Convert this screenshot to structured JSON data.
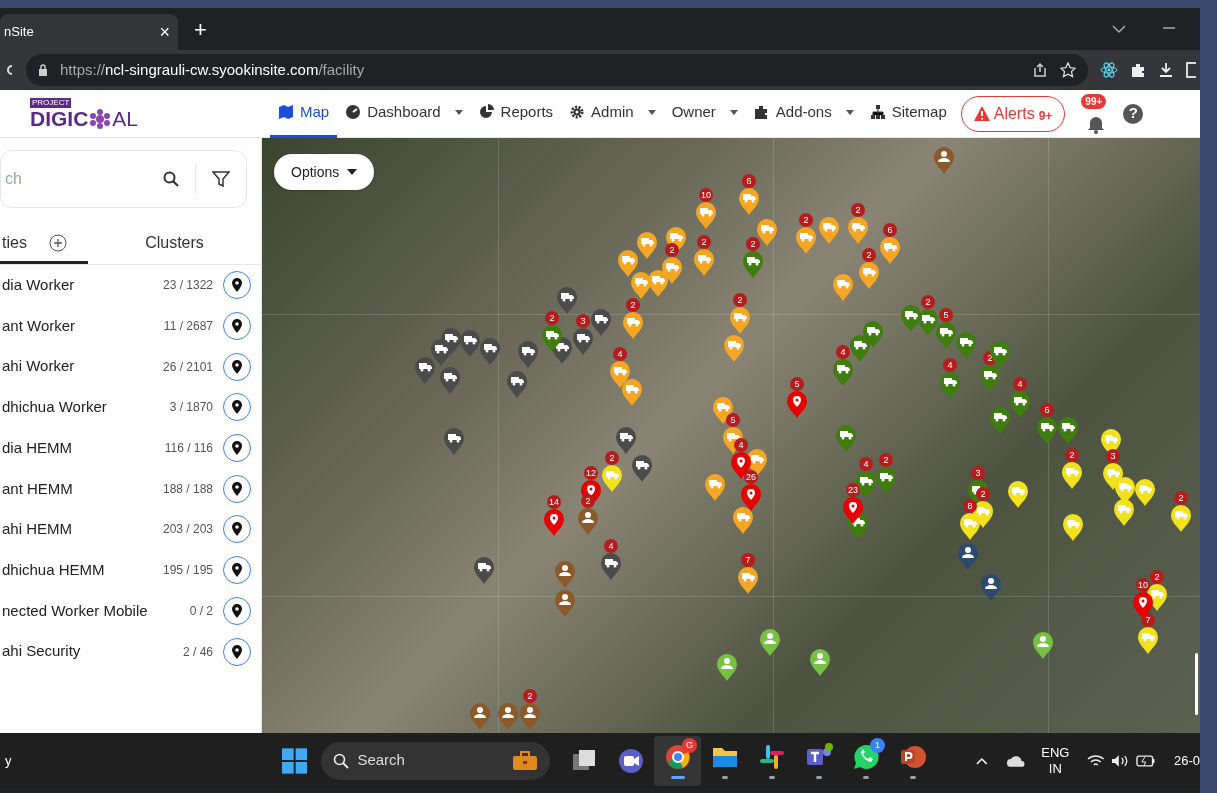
{
  "browser": {
    "tab_title": "nSite",
    "tab_close": "×",
    "new_tab": "+",
    "url_scheme": "https://",
    "url_host": "ncl-singrauli-cw.syookinsite.com",
    "url_path": "/facility"
  },
  "app": {
    "logo_tag": "PROJECT",
    "logo_left": "DIGIC",
    "logo_right": "AL",
    "nav": [
      {
        "label": "Map",
        "dropdown": false,
        "selected": true
      },
      {
        "label": "Dashboard",
        "dropdown": true,
        "selected": false
      },
      {
        "label": "Reports",
        "dropdown": false,
        "selected": false
      },
      {
        "label": "Admin",
        "dropdown": true,
        "selected": false
      },
      {
        "label": "Owner",
        "dropdown": true,
        "selected": false
      },
      {
        "label": "Add-ons",
        "dropdown": true,
        "selected": false
      },
      {
        "label": "Sitemap",
        "dropdown": false,
        "selected": false
      }
    ],
    "alerts": {
      "label": "Alerts",
      "count": "9+"
    },
    "notifications": "99+",
    "help": "?"
  },
  "sidebar": {
    "search": {
      "placeholder": "ch"
    },
    "tabs": [
      {
        "label": "ties",
        "add": true,
        "selected": true
      },
      {
        "label": "Clusters",
        "add": false,
        "selected": false
      }
    ],
    "items": [
      {
        "name": "dia Worker",
        "count": "23 / 1322"
      },
      {
        "name": "ant Worker",
        "count": "11 / 2687"
      },
      {
        "name": "ahi Worker",
        "count": "26 / 2101"
      },
      {
        "name": "dhichua Worker",
        "count": "3 / 1870"
      },
      {
        "name": "dia HEMM",
        "count": "116 / 116"
      },
      {
        "name": "ant HEMM",
        "count": "188 / 188"
      },
      {
        "name": "ahi HEMM",
        "count": "203 / 203"
      },
      {
        "name": "dhichua HEMM",
        "count": "195 / 195"
      },
      {
        "name": "nected Worker Mobile",
        "count": "0 / 2"
      },
      {
        "name": "ahi Security",
        "count": "2 / 46"
      }
    ]
  },
  "map": {
    "options_button": "Options",
    "markers": [
      {
        "kind": "truck",
        "color": "#4b4b4b"
      },
      {
        "kind": "truck",
        "color": "#4b4b4b"
      },
      {
        "kind": "truck",
        "color": "#4b4b4b",
        "badge": "3"
      },
      {
        "kind": "truck",
        "color": "#4b4b4b"
      },
      {
        "kind": "truck",
        "color": "#4b4b4b"
      },
      {
        "kind": "truck",
        "color": "#4b4b4b"
      },
      {
        "kind": "truck",
        "color": "#4b4b4b"
      },
      {
        "kind": "truck",
        "color": "#4b4b4b"
      },
      {
        "kind": "truck",
        "color": "#4b4b4b"
      },
      {
        "kind": "truck",
        "color": "#4b4b4b"
      },
      {
        "kind": "truck",
        "color": "#4b4b4b"
      },
      {
        "kind": "truck",
        "color": "#4b4b4b"
      },
      {
        "kind": "truck",
        "color": "#4b4b4b"
      },
      {
        "kind": "truck",
        "color": "#4b4b4b"
      },
      {
        "kind": "truck",
        "color": "#4b4b4b"
      },
      {
        "kind": "truck",
        "color": "#4b4b4b"
      },
      {
        "kind": "truck",
        "color": "#4b4b4b",
        "badge": "4"
      },
      {
        "kind": "truck",
        "color": "#f5a623",
        "badge": "10"
      },
      {
        "kind": "truck",
        "color": "#f5a623",
        "badge": "6"
      },
      {
        "kind": "truck",
        "color": "#f5a623"
      },
      {
        "kind": "truck",
        "color": "#f5a623"
      },
      {
        "kind": "truck",
        "color": "#f5a623",
        "badge": "2"
      },
      {
        "kind": "truck",
        "color": "#f5a623"
      },
      {
        "kind": "truck",
        "color": "#f5a623"
      },
      {
        "kind": "truck",
        "color": "#f5a623"
      },
      {
        "kind": "truck",
        "color": "#f5a623",
        "badge": "2"
      },
      {
        "kind": "truck",
        "color": "#f5a623"
      },
      {
        "kind": "truck",
        "color": "#f5a623",
        "badge": "2"
      },
      {
        "kind": "truck",
        "color": "#f5a623"
      },
      {
        "kind": "truck",
        "color": "#f5a623",
        "badge": "2"
      },
      {
        "kind": "truck",
        "color": "#f5a623",
        "badge": "2"
      },
      {
        "kind": "truck",
        "color": "#f5a623",
        "badge": "6"
      },
      {
        "kind": "truck",
        "color": "#f5a623"
      },
      {
        "kind": "truck",
        "color": "#f5a623",
        "badge": "2"
      },
      {
        "kind": "truck",
        "color": "#f5a623",
        "badge": "2"
      },
      {
        "kind": "truck",
        "color": "#f5a623"
      },
      {
        "kind": "truck",
        "color": "#f5a623",
        "badge": "4"
      },
      {
        "kind": "truck",
        "color": "#f5a623"
      },
      {
        "kind": "truck",
        "color": "#f5a623"
      },
      {
        "kind": "truck",
        "color": "#f5a623",
        "badge": "5"
      },
      {
        "kind": "truck",
        "color": "#f5a623"
      },
      {
        "kind": "truck",
        "color": "#f5a623"
      },
      {
        "kind": "truck",
        "color": "#f5a623"
      },
      {
        "kind": "truck",
        "color": "#f5a623",
        "badge": "7"
      },
      {
        "kind": "truck",
        "color": "#3f7d0f",
        "badge": "2"
      },
      {
        "kind": "truck",
        "color": "#3f7d0f",
        "badge": "2"
      },
      {
        "kind": "truck",
        "color": "#3f7d0f"
      },
      {
        "kind": "truck",
        "color": "#3f7d0f",
        "badge": "2"
      },
      {
        "kind": "truck",
        "color": "#3f7d0f"
      },
      {
        "kind": "truck",
        "color": "#3f7d0f"
      },
      {
        "kind": "truck",
        "color": "#3f7d0f",
        "badge": "4"
      },
      {
        "kind": "truck",
        "color": "#3f7d0f",
        "badge": "5"
      },
      {
        "kind": "truck",
        "color": "#3f7d0f"
      },
      {
        "kind": "truck",
        "color": "#3f7d0f",
        "badge": "4"
      },
      {
        "kind": "truck",
        "color": "#3f7d0f",
        "badge": "2"
      },
      {
        "kind": "truck",
        "color": "#3f7d0f"
      },
      {
        "kind": "truck",
        "color": "#3f7d0f",
        "badge": "4"
      },
      {
        "kind": "truck",
        "color": "#3f7d0f"
      },
      {
        "kind": "truck",
        "color": "#3f7d0f",
        "badge": "6"
      },
      {
        "kind": "truck",
        "color": "#3f7d0f"
      },
      {
        "kind": "truck",
        "color": "#3f7d0f"
      },
      {
        "kind": "truck",
        "color": "#3f7d0f",
        "badge": "4"
      },
      {
        "kind": "truck",
        "color": "#3f7d0f",
        "badge": "2"
      },
      {
        "kind": "truck",
        "color": "#3f7d0f"
      },
      {
        "kind": "truck",
        "color": "#3f7d0f",
        "badge": "3"
      },
      {
        "kind": "truck",
        "color": "#f2e21c",
        "badge": "2"
      },
      {
        "kind": "truck",
        "color": "#f2e21c"
      },
      {
        "kind": "truck",
        "color": "#f2e21c",
        "badge": "2"
      },
      {
        "kind": "truck",
        "color": "#f2e21c",
        "badge": "3"
      },
      {
        "kind": "truck",
        "color": "#f2e21c"
      },
      {
        "kind": "truck",
        "color": "#f2e21c"
      },
      {
        "kind": "truck",
        "color": "#f2e21c"
      },
      {
        "kind": "truck",
        "color": "#f2e21c"
      },
      {
        "kind": "truck",
        "color": "#f2e21c"
      },
      {
        "kind": "truck",
        "color": "#f2e21c",
        "badge": "2"
      },
      {
        "kind": "truck",
        "color": "#f2e21c",
        "badge": "8"
      },
      {
        "kind": "truck",
        "color": "#f2e21c",
        "badge": "2"
      },
      {
        "kind": "truck",
        "color": "#f2e21c",
        "badge": "2"
      },
      {
        "kind": "truck",
        "color": "#f2e21c",
        "badge": "7"
      },
      {
        "kind": "pin",
        "color": "#e60000",
        "badge": "5"
      },
      {
        "kind": "pin",
        "color": "#e60000",
        "badge": "4"
      },
      {
        "kind": "pin",
        "color": "#e60000",
        "badge": "12"
      },
      {
        "kind": "pin",
        "color": "#e60000",
        "badge": "26"
      },
      {
        "kind": "pin",
        "color": "#e60000",
        "badge": "14"
      },
      {
        "kind": "pin",
        "color": "#e60000",
        "badge": "23"
      },
      {
        "kind": "pin",
        "color": "#e60000",
        "badge": "10"
      },
      {
        "kind": "person",
        "color": "#8b5a2b"
      },
      {
        "kind": "person",
        "color": "#8b5a2b",
        "badge": "2"
      },
      {
        "kind": "person",
        "color": "#8b5a2b"
      },
      {
        "kind": "person",
        "color": "#8b5a2b"
      },
      {
        "kind": "person",
        "color": "#8b5a2b"
      },
      {
        "kind": "person",
        "color": "#8b5a2b"
      },
      {
        "kind": "person",
        "color": "#8b5a2b",
        "badge": "2"
      },
      {
        "kind": "person",
        "color": "#2c4a6b"
      },
      {
        "kind": "person",
        "color": "#2c4a6b"
      },
      {
        "kind": "person",
        "color": "#76c043"
      },
      {
        "kind": "person",
        "color": "#76c043"
      },
      {
        "kind": "person",
        "color": "#76c043"
      },
      {
        "kind": "person",
        "color": "#76c043"
      }
    ]
  },
  "taskbar": {
    "left_text": "y",
    "search_placeholder": "Search",
    "apps": [
      {
        "kind": "files",
        "running": false
      },
      {
        "kind": "meet",
        "running": false
      },
      {
        "kind": "chrome",
        "running": true,
        "badge": "G"
      },
      {
        "kind": "folder",
        "running": true
      },
      {
        "kind": "slack",
        "running": true
      },
      {
        "kind": "teams",
        "running": true
      },
      {
        "kind": "whatsapp",
        "running": true,
        "badge": "1"
      },
      {
        "kind": "powerpoint",
        "running": true
      }
    ],
    "language": "ENG",
    "region": "IN",
    "date": "26-0"
  }
}
